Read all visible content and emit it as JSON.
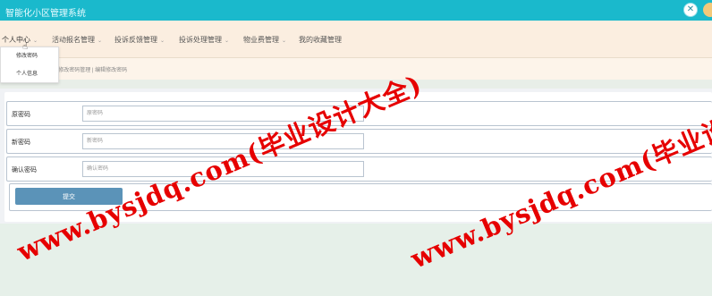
{
  "header": {
    "title": "智能化小区管理系统",
    "close_symbol": "✕"
  },
  "nav": {
    "items": [
      {
        "label": "个人中心"
      },
      {
        "label": "活动报名管理"
      },
      {
        "label": "投诉反馈管理"
      },
      {
        "label": "投诉处理管理"
      },
      {
        "label": "物业费管理"
      },
      {
        "label": "我的收藏管理"
      }
    ],
    "caret": "⌄"
  },
  "dropdown": {
    "items": [
      "修改密码",
      "个人信息"
    ]
  },
  "breadcrumb": "| 修改密码管理 | 编辑修改密码",
  "form": {
    "old_password": {
      "label": "原密码",
      "placeholder": "原密码"
    },
    "new_password": {
      "label": "新密码",
      "placeholder": "新密码"
    },
    "confirm_password": {
      "label": "确认密码",
      "placeholder": "确认密码"
    },
    "submit_label": "提交"
  },
  "watermark": {
    "text": "www.bysjdq.com(毕业设计大全)"
  },
  "colors": {
    "topbar": "#1ab9cc",
    "navbar": "#fbeee0",
    "submit": "#5b93b8",
    "watermark": "#e60000"
  }
}
